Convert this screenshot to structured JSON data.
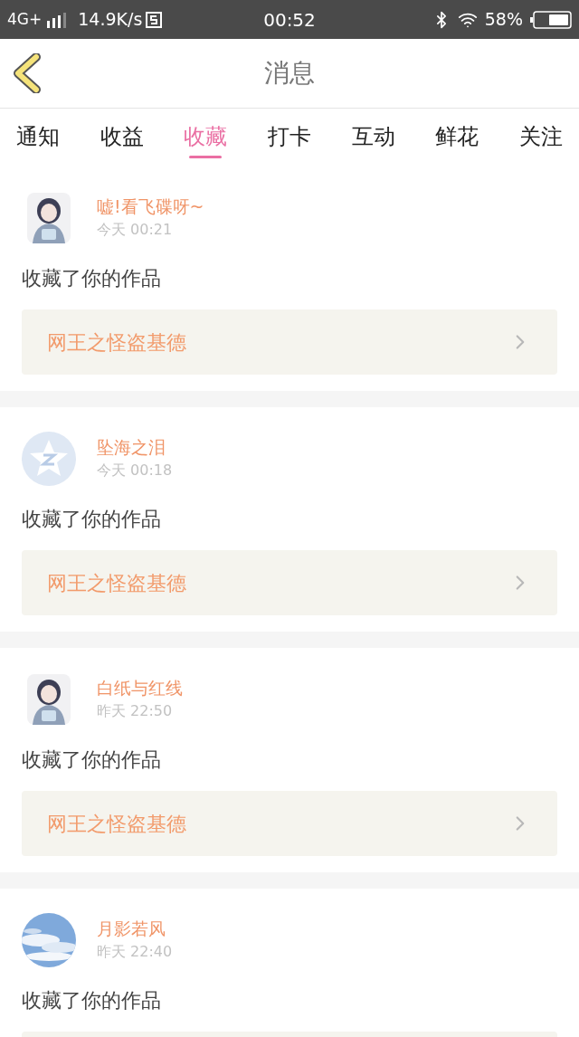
{
  "status_bar": {
    "network": "4G+",
    "speed": "14.9K/s",
    "time": "00:52",
    "battery": "58%"
  },
  "header": {
    "title": "消息"
  },
  "tabs": [
    {
      "label": "通知",
      "selected": false
    },
    {
      "label": "收益",
      "selected": false
    },
    {
      "label": "收藏",
      "selected": true
    },
    {
      "label": "打卡",
      "selected": false
    },
    {
      "label": "互动",
      "selected": false
    },
    {
      "label": "鲜花",
      "selected": false
    },
    {
      "label": "关注",
      "selected": false
    }
  ],
  "messages": [
    {
      "user": "嘘!看飞碟呀~",
      "time": "今天 00:21",
      "action": "收藏了你的作品",
      "work": "网王之怪盗基德"
    },
    {
      "avatar": {
        "kind": "default"
      },
      "user": "坠海之泪",
      "time": "今天 00:18",
      "action": "收藏了你的作品",
      "work": "网王之怪盗基德"
    },
    {
      "user": "白纸与红线",
      "time": "昨天 22:50",
      "action": "收藏了你的作品",
      "work": "网王之怪盗基德"
    },
    {
      "avatar": {
        "kind": "sky"
      },
      "user": "月影若风",
      "time": "昨天 22:40",
      "action": "收藏了你的作品"
    }
  ]
}
